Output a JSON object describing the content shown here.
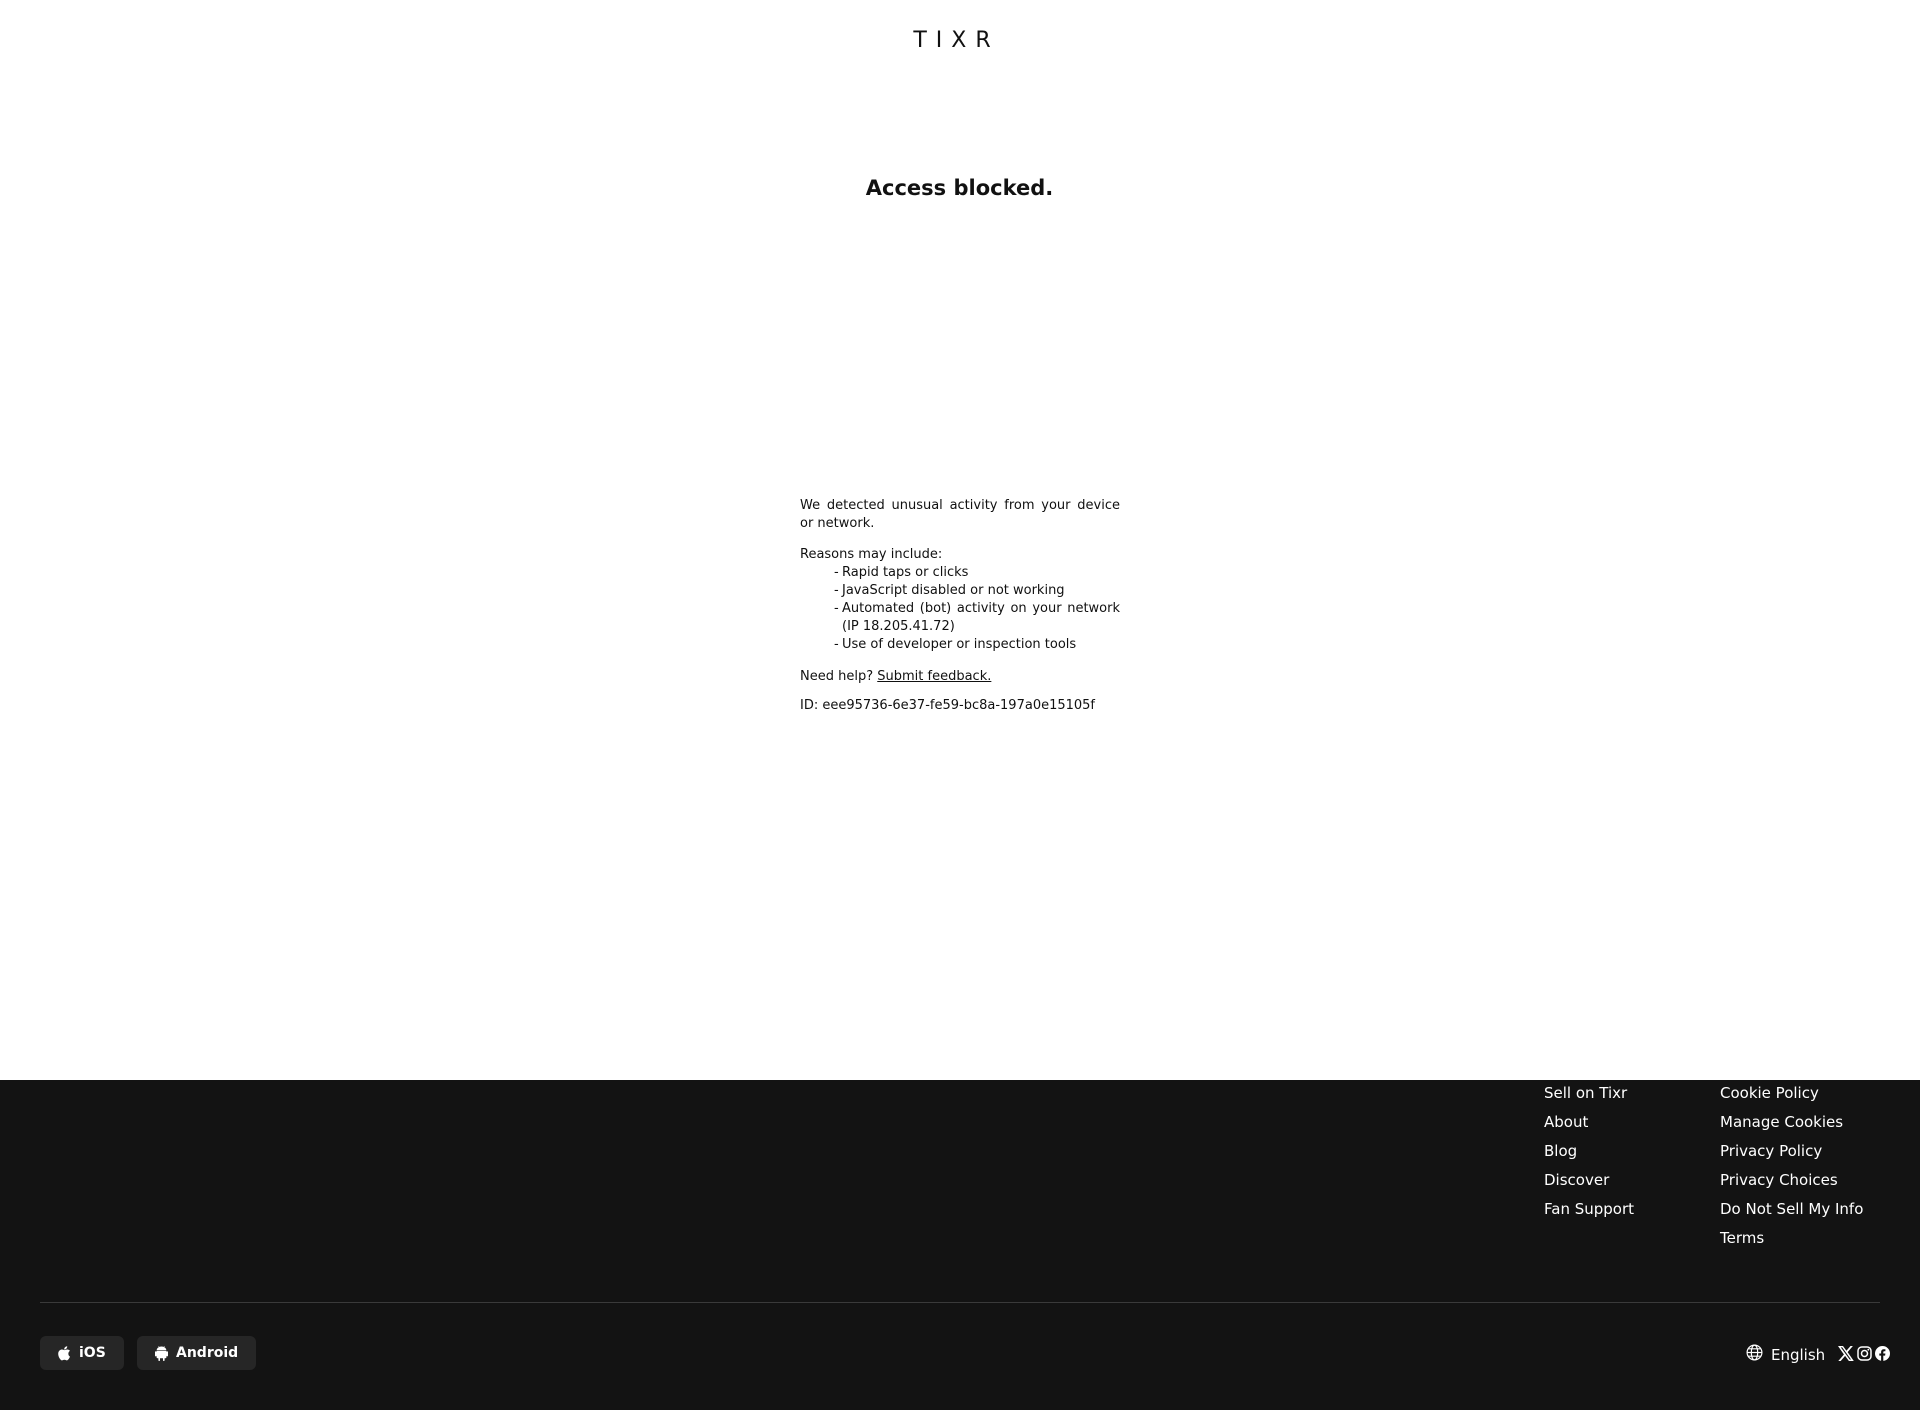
{
  "header": {
    "logo_text": "TIXR"
  },
  "main": {
    "title": "Access blocked.",
    "detected_text": "We detected unusual activity from your device or network.",
    "reasons_heading": "Reasons may include:",
    "reasons": [
      "Rapid taps or clicks",
      "JavaScript disabled or not working",
      "Automated (bot) activity on your network (IP 18.205.41.72)",
      "Use of developer or inspection tools"
    ],
    "help_prefix": "Need help?",
    "help_link": "Submit feedback.",
    "request_id": "ID: eee95736-6e37-fe59-bc8a-197a0e15105f"
  },
  "footer": {
    "links_col1": [
      "Sell on Tixr",
      "About",
      "Blog",
      "Discover",
      "Fan Support"
    ],
    "links_col2": [
      "Cookie Policy",
      "Manage Cookies",
      "Privacy Policy",
      "Privacy Choices",
      "Do Not Sell My Info",
      "Terms"
    ],
    "app_buttons": {
      "ios_label": "iOS",
      "android_label": "Android"
    },
    "language": "English",
    "social_icons": [
      "x-icon",
      "instagram-icon",
      "facebook-icon"
    ],
    "colors": {
      "background": "#131313",
      "button": "#262626",
      "text": "#ffffff"
    }
  }
}
